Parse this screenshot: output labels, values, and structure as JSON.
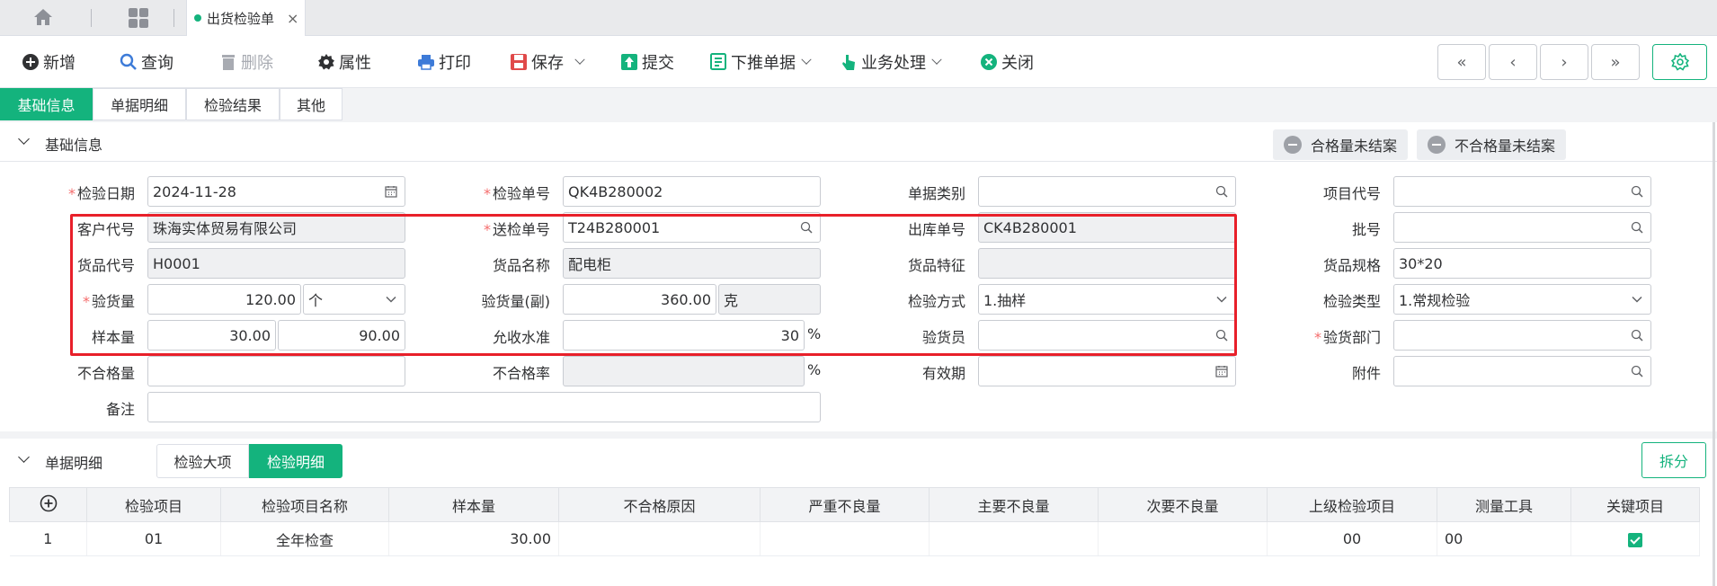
{
  "tabbar": {
    "doc_tab": "出货检验单",
    "close": "×"
  },
  "toolbar": {
    "new": "新增",
    "query": "查询",
    "delete": "删除",
    "props": "属性",
    "print": "打印",
    "save": "保存",
    "submit": "提交",
    "push": "下推单据",
    "biz": "业务处理",
    "close": "关闭",
    "nav": [
      "«",
      "‹",
      "›",
      "»"
    ]
  },
  "section_tabs": [
    "基础信息",
    "单据明细",
    "检验结果",
    "其他"
  ],
  "basic": {
    "title": "基础信息",
    "btn_pass": "合格量未结案",
    "btn_fail": "不合格量未结案",
    "labels": {
      "date": "检验日期",
      "doc_no": "检验单号",
      "doc_type": "单据类别",
      "item_code": "项目代号",
      "cust": "客户代号",
      "send_no": "送检单号",
      "out_no": "出库单号",
      "batch": "批号",
      "goods_code": "货品代号",
      "goods_name": "货品名称",
      "goods_feat": "货品特征",
      "goods_spec": "货品规格",
      "insp_qty": "验货量",
      "insp_qty2": "验货量(副)",
      "method": "检验方式",
      "insp_type": "检验类型",
      "sample": "样本量",
      "aql": "允收水准",
      "inspector": "验货员",
      "dept": "验货部门",
      "defect_qty": "不合格量",
      "defect_rate": "不合格率",
      "expiry": "有效期",
      "attach": "附件",
      "remark": "备注"
    },
    "values": {
      "date": "2024-11-28",
      "doc_no": "QK4B280002",
      "doc_type": "",
      "item_code": "",
      "cust": "珠海实体贸易有限公司",
      "send_no": "T24B280001",
      "out_no": "CK4B280001",
      "batch": "",
      "goods_code": "H0001",
      "goods_name": "配电柜",
      "goods_feat": "",
      "goods_spec": "30*20",
      "insp_qty": "120.00",
      "insp_unit": "个",
      "insp_qty2": "360.00",
      "insp_unit2": "克",
      "method": "1.抽样",
      "insp_type": "1.常规检验",
      "sample": "30.00",
      "sample2": "90.00",
      "aql": "30",
      "pct": "%",
      "inspector": "",
      "dept": "",
      "defect_qty": "",
      "defect_rate": "",
      "expiry": "",
      "attach": "",
      "remark": ""
    }
  },
  "detail": {
    "title": "单据明细",
    "tab1": "检验大项",
    "tab2": "检验明细",
    "split": "拆分",
    "columns": [
      "检验项目",
      "检验项目名称",
      "样本量",
      "不合格原因",
      "严重不良量",
      "主要不良量",
      "次要不良量",
      "上级检验项目",
      "测量工具",
      "关键项目"
    ],
    "rows": [
      {
        "no": "1",
        "item": "01",
        "name": "全年检查",
        "sample": "30.00",
        "reason": "",
        "severe": "",
        "major": "",
        "minor": "",
        "parent": "00",
        "tool": "00",
        "key": true
      }
    ]
  },
  "colors": {
    "accent": "#14b37d",
    "required": "#f56c6c",
    "highlight": "#e8202a"
  }
}
